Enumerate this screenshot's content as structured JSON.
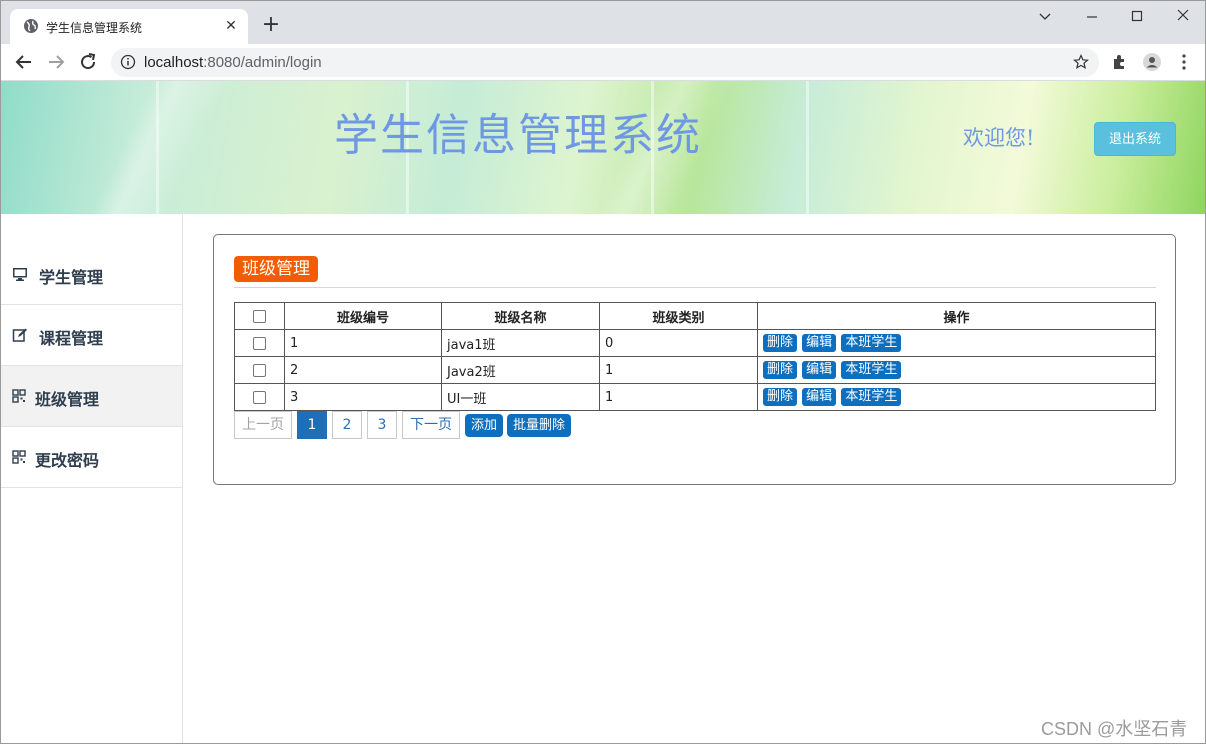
{
  "browser": {
    "tab_title": "学生信息管理系统",
    "url_host": "localhost",
    "url_path": ":8080/admin/login"
  },
  "header": {
    "site_title": "学生信息管理系统",
    "welcome": "欢迎您!",
    "logout_label": "退出系统"
  },
  "sidebar": {
    "items": [
      {
        "label": "学生管理",
        "icon": "monitor-icon",
        "active": false
      },
      {
        "label": "课程管理",
        "icon": "edit-icon",
        "active": false
      },
      {
        "label": "班级管理",
        "icon": "qrcode-icon",
        "active": true
      },
      {
        "label": "更改密码",
        "icon": "qrcode-icon",
        "active": false
      }
    ]
  },
  "main": {
    "section_title": "班级管理",
    "table": {
      "columns": [
        "班级编号",
        "班级名称",
        "班级类别",
        "操作"
      ],
      "rows": [
        {
          "id": "1",
          "name": "java1班",
          "category": "0"
        },
        {
          "id": "2",
          "name": "Java2班",
          "category": "1"
        },
        {
          "id": "3",
          "name": "UI一班",
          "category": "1"
        }
      ],
      "row_actions": [
        "删除",
        "编辑",
        "本班学生"
      ]
    },
    "pagination": {
      "prev": "上一页",
      "pages": [
        "1",
        "2",
        "3"
      ],
      "current": "1",
      "next": "下一页"
    },
    "actions": {
      "add": "添加",
      "batch_delete": "批量删除"
    }
  },
  "watermark": "CSDN @水坚石青",
  "colors": {
    "section_badge": "#f25c05",
    "action_button": "#0e6fbf",
    "logout_button": "#5bc0de",
    "title_text": "#6f98e4"
  }
}
